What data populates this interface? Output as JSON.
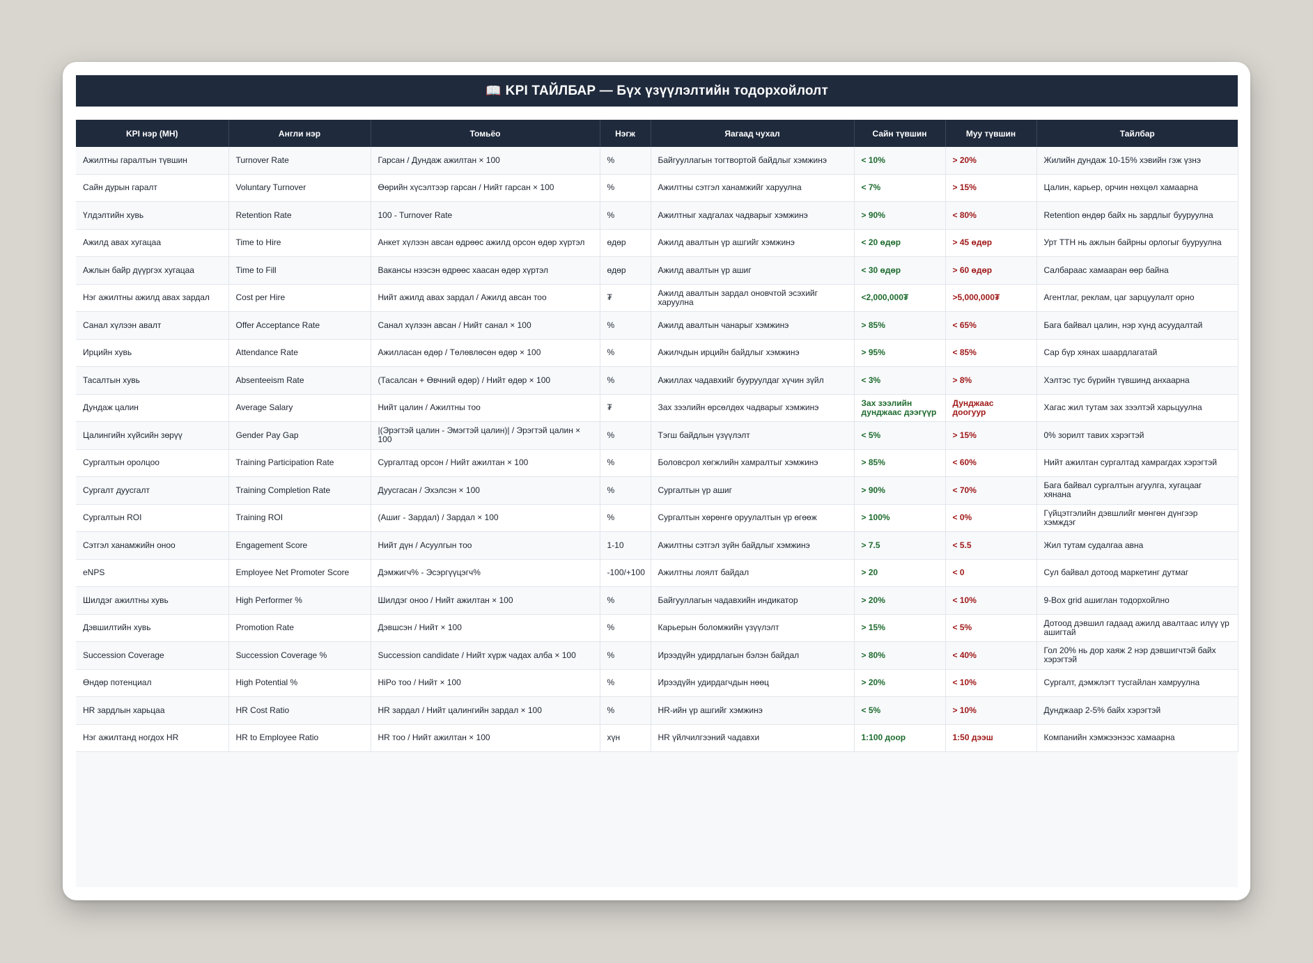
{
  "title": {
    "icon": "open-book-icon",
    "icon_glyph": "📖",
    "text": "KPI ТАЙЛБАР — Бүх үзүүлэлтийн тодорхойлолт"
  },
  "colors": {
    "header_bg": "#1f2a3c",
    "good": "#1e6b2e",
    "bad": "#a01a1a"
  },
  "table": {
    "headers": [
      "KPI нэр (МН)",
      "Англи нэр",
      "Томьёо",
      "Нэгж",
      "Яагаад чухал",
      "Сайн түвшин",
      "Муу түвшин",
      "Тайлбар"
    ],
    "rows": [
      [
        "Ажилтны гаралтын түвшин",
        "Turnover Rate",
        "Гарсан / Дундаж ажилтан × 100",
        "%",
        "Байгууллагын тогтвортой байдлыг хэмжинэ",
        "< 10%",
        "> 20%",
        "Жилийн дундаж 10-15% хэвийн гэж үзнэ"
      ],
      [
        "Сайн дурын гаралт",
        "Voluntary Turnover",
        "Өөрийн хүсэлтээр гарсан / Нийт гарсан × 100",
        "%",
        "Ажилтны сэтгэл ханамжийг харуулна",
        "< 7%",
        "> 15%",
        "Цалин, карьер, орчин нөхцөл хамаарна"
      ],
      [
        "Үлдэлтийн хувь",
        "Retention Rate",
        "100 - Turnover Rate",
        "%",
        "Ажилтныг хадгалах чадварыг хэмжинэ",
        "> 90%",
        "< 80%",
        "Retention өндөр байх нь зардлыг бууруулна"
      ],
      [
        "Ажилд авах хугацаа",
        "Time to Hire",
        "Анкет хүлээн авсан өдрөөс ажилд орсон өдөр хүртэл",
        "өдөр",
        "Ажилд авалтын үр ашгийг хэмжинэ",
        "< 20 өдөр",
        "> 45 өдөр",
        "Урт TTH нь ажлын байрны орлогыг бууруулна"
      ],
      [
        "Ажлын байр дүүргэх хугацаа",
        "Time to Fill",
        "Вакансы нээсэн өдрөөс хаасан өдөр хүртэл",
        "өдөр",
        "Ажилд авалтын үр ашиг",
        "< 30 өдөр",
        "> 60 өдөр",
        "Салбараас хамааран өөр байна"
      ],
      [
        "Нэг ажилтны ажилд авах зардал",
        "Cost per Hire",
        "Нийт ажилд авах зардал / Ажилд авсан тоо",
        "₮",
        "Ажилд авалтын зардал оновчтой эсэхийг харуулна",
        "<2,000,000₮",
        ">5,000,000₮",
        "Агентлаг, реклам, цаг зарцуулалт орно"
      ],
      [
        "Санал хүлээн авалт",
        "Offer Acceptance Rate",
        "Санал хүлээн авсан / Нийт санал × 100",
        "%",
        "Ажилд авалтын чанарыг хэмжинэ",
        "> 85%",
        "< 65%",
        "Бага байвал цалин, нэр хүнд асуудалтай"
      ],
      [
        "Ирцийн хувь",
        "Attendance Rate",
        "Ажилласан өдөр / Төлөвлөсөн өдөр × 100",
        "%",
        "Ажилчдын ирцийн байдлыг хэмжинэ",
        "> 95%",
        "< 85%",
        "Сар бүр хянах шаардлагатай"
      ],
      [
        "Тасалтын хувь",
        "Absenteeism Rate",
        "(Тасалсан + Өвчний өдөр) / Нийт өдөр × 100",
        "%",
        "Ажиллах чадавхийг бууруулдаг хүчин зүйл",
        "< 3%",
        "> 8%",
        "Хэлтэс тус бүрийн түвшинд анхаарна"
      ],
      [
        "Дундаж цалин",
        "Average Salary",
        "Нийт цалин / Ажилтны тоо",
        "₮",
        "Зах зээлийн өрсөлдөх чадварыг хэмжинэ",
        "Зах зээлийн дунджаас дээгүүр",
        "Дунджаас доогуур",
        "Хагас жил тутам зах зээлтэй харьцуулна"
      ],
      [
        "Цалингийн хүйсийн зөрүү",
        "Gender Pay Gap",
        "|(Эрэгтэй цалин - Эмэгтэй цалин)| / Эрэгтэй цалин × 100",
        "%",
        "Тэгш байдлын үзүүлэлт",
        "< 5%",
        "> 15%",
        "0% зорилт тавих хэрэгтэй"
      ],
      [
        "Сургалтын оролцоо",
        "Training Participation Rate",
        "Сургалтад орсон / Нийт ажилтан × 100",
        "%",
        "Боловсрол хөгжлийн хамралтыг хэмжинэ",
        "> 85%",
        "< 60%",
        "Нийт ажилтан сургалтад хамрагдах хэрэгтэй"
      ],
      [
        "Сургалт дуусгалт",
        "Training Completion Rate",
        "Дуусгасан / Эхэлсэн × 100",
        "%",
        "Сургалтын үр ашиг",
        "> 90%",
        "< 70%",
        "Бага байвал сургалтын агуулга, хугацааг хянана"
      ],
      [
        "Сургалтын ROI",
        "Training ROI",
        "(Ашиг - Зардал) / Зардал × 100",
        "%",
        "Сургалтын хөрөнгө оруулалтын үр өгөөж",
        "> 100%",
        "< 0%",
        "Гүйцэтгэлийн дэвшлийг мөнгөн дүнгээр хэмждэг"
      ],
      [
        "Сэтгэл ханамжийн оноо",
        "Engagement Score",
        "Нийт дүн / Асуулгын тоо",
        "1-10",
        "Ажилтны сэтгэл зүйн байдлыг хэмжинэ",
        "> 7.5",
        "< 5.5",
        "Жил тутам судалгаа авна"
      ],
      [
        "eNPS",
        "Employee Net Promoter Score",
        "Дэмжигч% - Эсэргүүцэгч%",
        "-100/+100",
        "Ажилтны лоялт байдал",
        "> 20",
        "< 0",
        "Сул байвал дотоод маркетинг дутмаг"
      ],
      [
        "Шилдэг ажилтны хувь",
        "High Performer %",
        "Шилдэг оноо / Нийт ажилтан × 100",
        "%",
        "Байгууллагын чадавхийн индикатор",
        "> 20%",
        "< 10%",
        "9-Box grid ашиглан тодорхойлно"
      ],
      [
        "Дэвшилтийн хувь",
        "Promotion Rate",
        "Дэвшсэн / Нийт × 100",
        "%",
        "Карьерын боломжийн үзүүлэлт",
        "> 15%",
        "< 5%",
        "Дотоод дэвшил гадаад ажилд авалтаас илүү үр ашигтай"
      ],
      [
        "Succession Coverage",
        "Succession Coverage %",
        "Succession candidate / Нийт хүрж чадах алба × 100",
        "%",
        "Ирээдүйн удирдлагын бэлэн байдал",
        "> 80%",
        "< 40%",
        "Гол 20% нь дор хаяж 2 нэр дэвшигчтэй байх хэрэгтэй"
      ],
      [
        "Өндөр потенциал",
        "High Potential %",
        "HiPo тоо / Нийт × 100",
        "%",
        "Ирээдүйн удирдагчдын нөөц",
        "> 20%",
        "< 10%",
        "Сургалт, дэмжлэгт тусгайлан хамруулна"
      ],
      [
        "HR зардлын харьцаа",
        "HR Cost Ratio",
        "HR зардал / Нийт цалингийн зардал × 100",
        "%",
        "HR-ийн үр ашгийг хэмжинэ",
        "< 5%",
        "> 10%",
        "Дунджаар 2-5% байх хэрэгтэй"
      ],
      [
        "Нэг ажилтанд ногдох HR",
        "HR to Employee Ratio",
        "HR тоо / Нийт ажилтан × 100",
        "хүн",
        "HR үйлчилгээний чадавхи",
        "1:100 доор",
        "1:50 дээш",
        "Компанийн хэмжээнээс хамаарна"
      ]
    ]
  }
}
